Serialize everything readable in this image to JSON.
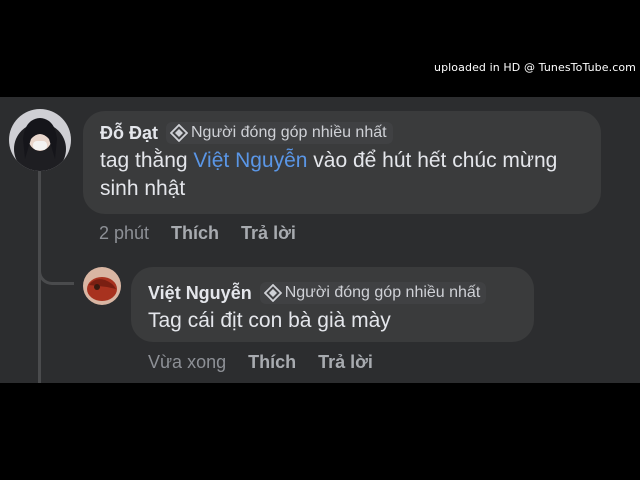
{
  "watermark": "uploaded in HD @ TunesToTube.com",
  "comments": [
    {
      "author": "Đỗ Đạt",
      "badge": "Người đóng góp nhiều nhất",
      "text_before": "tag thằng ",
      "mention": "Việt Nguyễn",
      "text_after_line1": " vào để hút hết chúc mừng",
      "text_line2": "sinh nhật",
      "time": "2 phút",
      "like": "Thích",
      "reply": "Trả lời"
    },
    {
      "author": "Việt Nguyễn",
      "badge": "Người đóng góp nhiều nhất",
      "text": "Tag cái địt con bà già mày",
      "time": "Vừa xong",
      "like": "Thích",
      "reply": "Trả lời"
    }
  ],
  "colors": {
    "panel": "#2c2d2f",
    "bubble": "#3a3b3c",
    "mention": "#5a96e6",
    "text": "#e4e6eb",
    "muted": "#8d9096"
  },
  "icons": {
    "badge": "diamond-badge-icon"
  }
}
